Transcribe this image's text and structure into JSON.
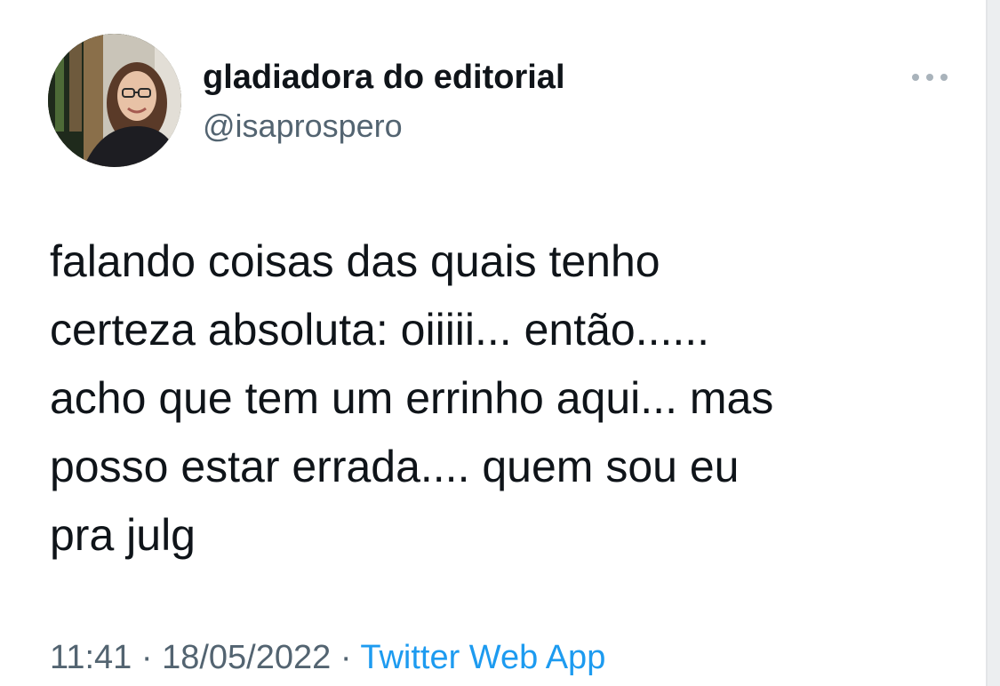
{
  "author": {
    "display_name": "gladiadora do editorial",
    "handle": "@isaprospero",
    "avatar_icon": "profile-photo"
  },
  "tweet": {
    "lines": [
      "falando coisas das quais tenho",
      "certeza absoluta: oiiiii... então......",
      "acho que tem um errinho aqui... mas",
      "posso estar errada.... quem sou eu",
      "pra julg"
    ]
  },
  "meta": {
    "time": "11:41",
    "separator": "·",
    "date": "18/05/2022",
    "source": "Twitter Web App"
  },
  "colors": {
    "text_primary": "#0f1419",
    "text_secondary": "#536471",
    "link": "#1d9bf0"
  },
  "icons": {
    "more": "more-dots-icon"
  }
}
